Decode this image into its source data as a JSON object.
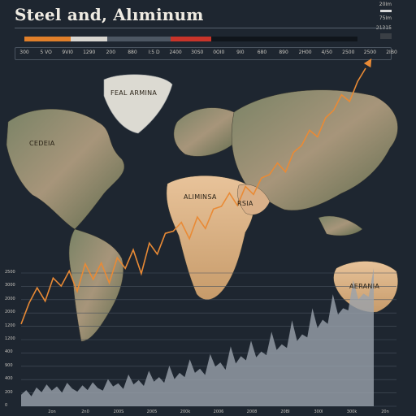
{
  "title": "Steel and, Alıminum",
  "legend_right": {
    "top": "20Im",
    "mid": "75Im",
    "low": "21315"
  },
  "progress_segments": [
    {
      "color": "#e07f2a",
      "share": 0.14
    },
    {
      "color": "#d8d6d0",
      "share": 0.11
    },
    {
      "color": "#4d5763",
      "share": 0.19
    },
    {
      "color": "#c8342a",
      "share": 0.12
    },
    {
      "color": "#10151b",
      "share": 0.44
    }
  ],
  "header_ticks": [
    "300",
    "5 VO",
    "9VI0",
    "1290",
    "200",
    "880",
    "I:5 D",
    "2400",
    "30S0",
    "0OI0",
    "9I0",
    "680",
    "890",
    "2H00",
    "4/50",
    "2500",
    "2500",
    "2IB0"
  ],
  "map_labels": {
    "greenland": "FEAL ARMINA",
    "canada": "CEDEIA",
    "africa": "ALIMINSA",
    "arabia": "RSIA",
    "australia": "AERANIA"
  },
  "chart_data": {
    "type": "area",
    "title": "",
    "y_tick_labels": [
      "2500",
      "3000",
      "2000",
      "2000",
      "1200",
      "1200",
      "400",
      "900",
      "400",
      "200",
      "0"
    ],
    "x_tick_labels": [
      "2on",
      "2n0",
      "200S",
      "2005",
      "200k",
      "2006",
      "2008",
      "20BI",
      "300I",
      "300k",
      "20n"
    ],
    "trend_line": {
      "color": "#e98a35"
    },
    "area": {
      "color": "#9aa3ad"
    },
    "trend_values": [
      1220,
      1700,
      2040,
      1740,
      2260,
      2080,
      2420,
      1960,
      2580,
      2230,
      2600,
      2150,
      2720,
      2480,
      2900,
      2360,
      3050,
      2800,
      3270,
      3320,
      3520,
      3150,
      3640,
      3380,
      3820,
      3880,
      4180,
      3900,
      4330,
      4150,
      4520,
      4600,
      4860,
      4660,
      5100,
      5250,
      5600,
      5450,
      5880,
      6050,
      6400,
      6250,
      6700,
      7000
    ],
    "area_values": [
      220,
      310,
      190,
      360,
      270,
      420,
      300,
      380,
      260,
      450,
      340,
      280,
      400,
      310,
      460,
      350,
      300,
      520,
      380,
      440,
      330,
      610,
      420,
      500,
      390,
      680,
      470,
      560,
      450,
      780,
      520,
      640,
      560,
      900,
      640,
      720,
      600,
      1000,
      760,
      840,
      700,
      1150,
      820,
      960,
      880,
      1260,
      940,
      1050,
      980,
      1430,
      1080,
      1190,
      1120,
      1650,
      1250,
      1380,
      1320,
      1880,
      1500,
      1660,
      1580,
      2150,
      1760,
      1880,
      1840,
      2420,
      2050,
      2160,
      2100,
      2650
    ]
  }
}
